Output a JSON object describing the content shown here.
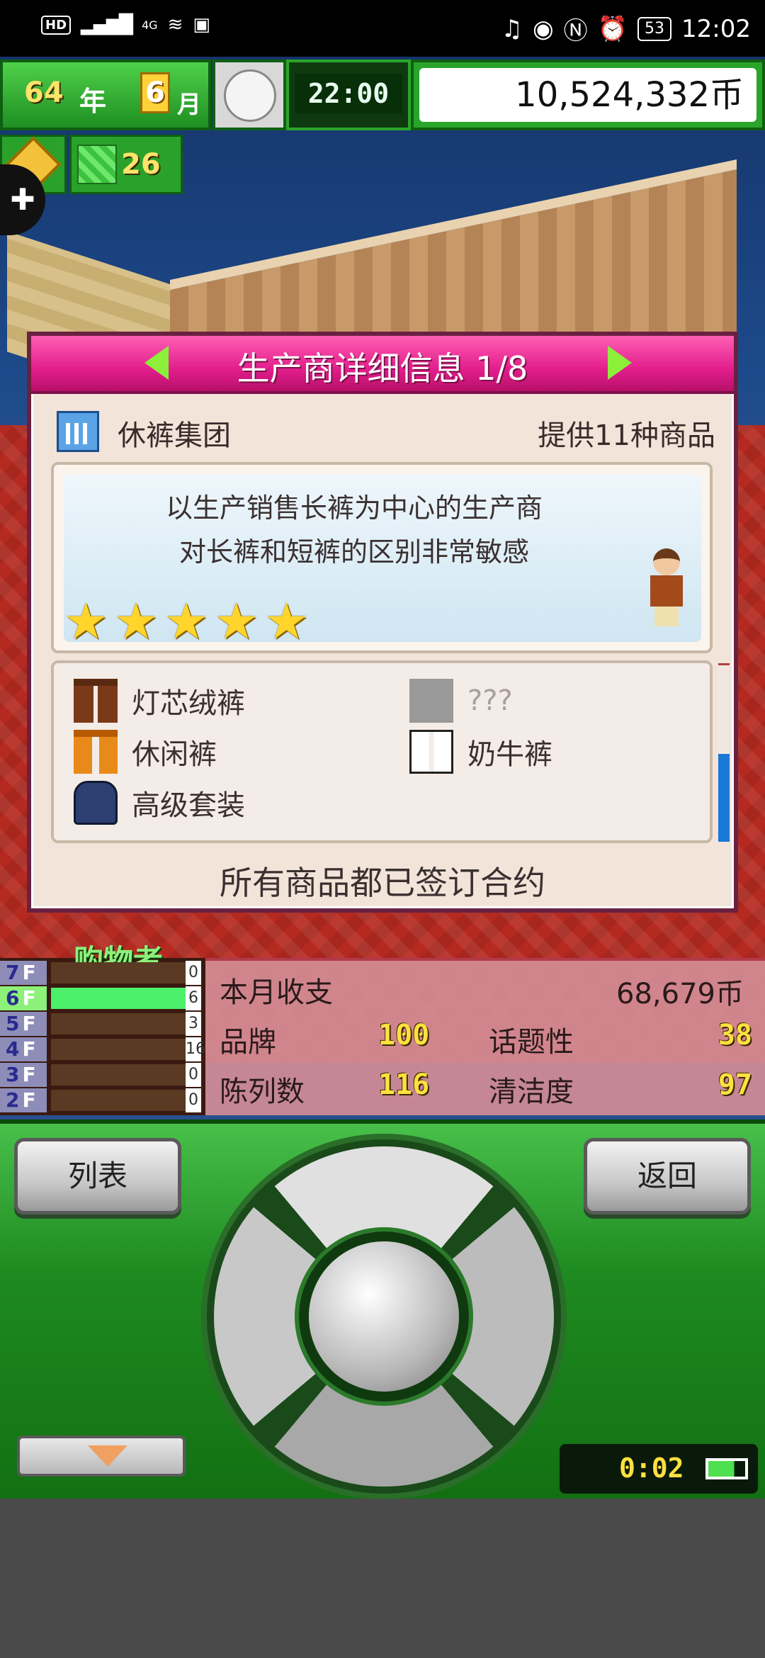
{
  "status_bar": {
    "hd": "HD",
    "network": "4G",
    "battery": "53",
    "time": "12:02"
  },
  "hud": {
    "year": "64",
    "year_unit": "年",
    "month": "6",
    "month_unit": "月",
    "time": "22:00",
    "money": "10,524,332币",
    "points": "26"
  },
  "panel": {
    "title": "生产商详细信息 1/8",
    "maker_name": "休裤集团",
    "product_count": "提供11种商品",
    "description_line1": "以生产销售长裤为中心的生产商",
    "description_line2": "对长裤和短裤的区别非常敏感",
    "rating_stars": 5,
    "goods": [
      {
        "name": "灯芯绒裤",
        "icon": "corduroy-pants-icon"
      },
      {
        "name": "???",
        "icon": "unknown-item-icon"
      },
      {
        "name": "休闲裤",
        "icon": "casual-pants-icon"
      },
      {
        "name": "奶牛裤",
        "icon": "cow-pants-icon"
      },
      {
        "name": "高级套装",
        "icon": "luxury-suit-icon"
      }
    ],
    "contract_status": "所有商品都已签订合约"
  },
  "floors": {
    "label": "购物者",
    "rows": [
      {
        "floor": "7",
        "shoppers": "0"
      },
      {
        "floor": "6",
        "shoppers": "6"
      },
      {
        "floor": "5",
        "shoppers": "3"
      },
      {
        "floor": "4",
        "shoppers": "16"
      },
      {
        "floor": "3",
        "shoppers": "0"
      },
      {
        "floor": "2",
        "shoppers": "0"
      }
    ],
    "floor_suffix": "F"
  },
  "stats": {
    "income_label": "本月收支",
    "income_value": "68,679币",
    "brand_label": "品牌",
    "brand_value": "100",
    "topic_label": "话题性",
    "topic_value": "38",
    "display_label": "陈列数",
    "display_value": "116",
    "clean_label": "清洁度",
    "clean_value": "97"
  },
  "controller": {
    "list_button": "列表",
    "back_button": "返回",
    "play_time": "0:02"
  },
  "colors": {
    "panel_header": "#e21e8c",
    "arrow": "#8cef3a",
    "star": "#ffd52b",
    "hud_green": "#29a52a"
  }
}
